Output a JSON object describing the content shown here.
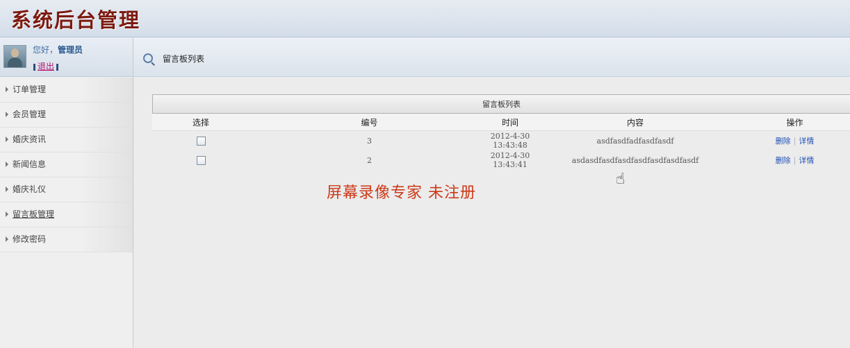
{
  "header": {
    "title": "系统后台管理"
  },
  "user": {
    "greeting_prefix": "您好，",
    "name": "管理员",
    "logout_label": "退出"
  },
  "sidebar": {
    "items": [
      {
        "label": "订单管理",
        "active": false
      },
      {
        "label": "会员管理",
        "active": false
      },
      {
        "label": "婚庆资讯",
        "active": false
      },
      {
        "label": "新闻信息",
        "active": false
      },
      {
        "label": "婚庆礼仪",
        "active": false
      },
      {
        "label": "留言板管理",
        "active": true
      },
      {
        "label": "修改密码",
        "active": false
      }
    ]
  },
  "content": {
    "breadcrumb_title": "留言板列表",
    "table": {
      "title": "留言板列表",
      "columns": [
        "选择",
        "编号",
        "时间",
        "内容",
        "操作"
      ],
      "rows": [
        {
          "id": "3",
          "time": "2012-4-30 13:43:48",
          "content": "asdfasdfadfasdfasdf",
          "delete_label": "删除",
          "detail_label": "详情"
        },
        {
          "id": "2",
          "time": "2012-4-30 13:43:41",
          "content": "asdasdfasdfasdfasdfasdfasdfasdf",
          "delete_label": "删除",
          "detail_label": "详情"
        }
      ]
    }
  },
  "watermark": "屏幕录像专家  未注册"
}
